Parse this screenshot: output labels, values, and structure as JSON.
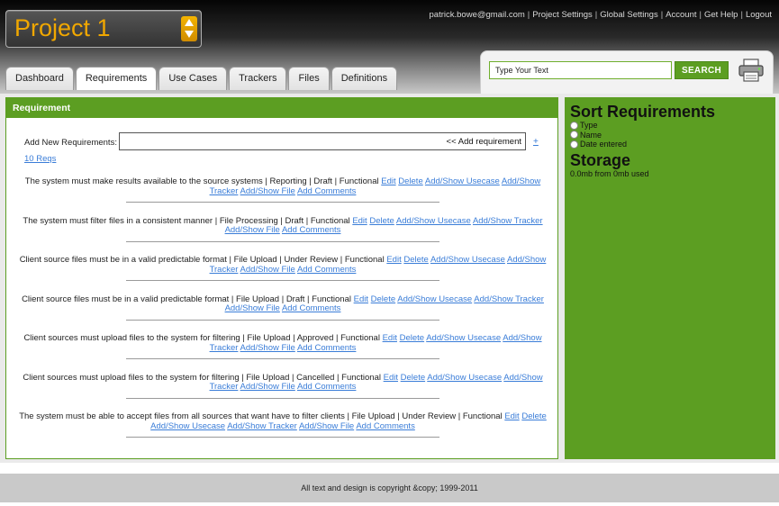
{
  "header": {
    "project_name": "Project 1",
    "top_links": [
      "patrick.bowe@gmail.com",
      "Project Settings",
      "Global Settings",
      "Account",
      "Get Help",
      "Logout"
    ],
    "tabs": [
      {
        "label": "Dashboard",
        "active": false
      },
      {
        "label": "Requirements",
        "active": true
      },
      {
        "label": "Use Cases",
        "active": false
      },
      {
        "label": "Trackers",
        "active": false
      },
      {
        "label": "Files",
        "active": false
      },
      {
        "label": "Definitions",
        "active": false
      }
    ],
    "search": {
      "value": "Type Your Text",
      "button_label": "SEARCH"
    }
  },
  "requirements_panel": {
    "title": "Requirement",
    "add_label": "Add New Requirements:",
    "add_input_value": "<< Add requirement",
    "add_plus": "+",
    "count_label": "10 Reqs",
    "items": [
      {
        "text": "The system must make results available to the source systems | Reporting | Draft | Functional",
        "links": [
          "Edit",
          "Delete",
          "Add/Show Usecase",
          "Add/Show Tracker",
          "Add/Show File",
          "Add Comments"
        ]
      },
      {
        "text": "The system must filter files in a consistent manner | File Processing | Draft | Functional",
        "links": [
          "Edit",
          "Delete",
          "Add/Show Usecase",
          "Add/Show Tracker",
          "Add/Show File",
          "Add Comments"
        ]
      },
      {
        "text": "Client source files must be in a valid predictable format | File Upload | Under Review | Functional",
        "links": [
          "Edit",
          "Delete",
          "Add/Show Usecase",
          "Add/Show Tracker",
          "Add/Show File",
          "Add Comments"
        ]
      },
      {
        "text": "Client source files must be in a valid predictable format | File Upload | Draft | Functional",
        "links": [
          "Edit",
          "Delete",
          "Add/Show Usecase",
          "Add/Show Tracker",
          "Add/Show File",
          "Add Comments"
        ]
      },
      {
        "text": "Client sources must upload files to the system for filtering | File Upload | Approved | Functional",
        "links": [
          "Edit",
          "Delete",
          "Add/Show Usecase",
          "Add/Show Tracker",
          "Add/Show File",
          "Add Comments"
        ]
      },
      {
        "text": "Client sources must upload files to the system for filtering | File Upload | Cancelled | Functional",
        "links": [
          "Edit",
          "Delete",
          "Add/Show Usecase",
          "Add/Show Tracker",
          "Add/Show File",
          "Add Comments"
        ]
      },
      {
        "text": "The system must be able to accept files from all sources that want have to filter clients | File Upload | Under Review | Functional",
        "links": [
          "Edit",
          "Delete",
          "Add/Show Usecase",
          "Add/Show Tracker",
          "Add/Show File",
          "Add Comments"
        ]
      }
    ]
  },
  "sidebar": {
    "sort_title": "Sort Requirements",
    "sort_options": [
      "Type",
      "Name",
      "Date entered"
    ],
    "storage_title": "Storage",
    "storage_text": "0.0mb from 0mb used"
  },
  "footer": {
    "text": "All text and design is copyright &copy; 1999-2011"
  },
  "colors": {
    "accent_green": "#5c9e22",
    "project_orange": "#f0a700",
    "link_blue": "#3a7dd8"
  }
}
